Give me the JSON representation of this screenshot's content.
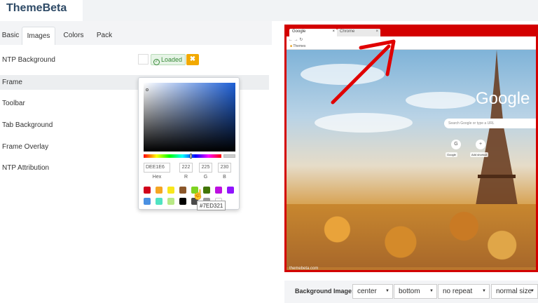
{
  "app": {
    "brand": "ThemeBeta"
  },
  "tabs": [
    {
      "label": "Basic"
    },
    {
      "label": "Images"
    },
    {
      "label": "Colors"
    },
    {
      "label": "Pack"
    }
  ],
  "settings": [
    {
      "label": "NTP Background"
    },
    {
      "label": "Frame"
    },
    {
      "label": "Toolbar"
    },
    {
      "label": "Tab Background"
    },
    {
      "label": "Frame Overlay"
    },
    {
      "label": "NTP Attribution"
    }
  ],
  "ntp_status": {
    "loaded_label": "Loaded",
    "clear_label": "✖"
  },
  "color_picker": {
    "hex": "DEE1E6",
    "r": "222",
    "g": "225",
    "b": "230",
    "hex_label": "Hex",
    "r_label": "R",
    "g_label": "G",
    "b_label": "B",
    "swatches": [
      "#d0021b",
      "#f5a623",
      "#f8e71c",
      "#8b572a",
      "#7ed321",
      "#417505",
      "#bd10e0",
      "#9013fe",
      "#4a90e2",
      "#50e3c2",
      "#b8e986",
      "#000000",
      "#4a4a4a",
      "#9b9b9b",
      "#ffffff"
    ],
    "tooltip": "#7ED321"
  },
  "preview": {
    "tab_active": "Google",
    "tab_inactive": "Chrome",
    "bookmark": "Themes",
    "google_logo": "Google",
    "search_placeholder": "Search Google or type a URL",
    "shortcut_google": "Google",
    "shortcut_add": "Add shortcut",
    "watermark": "themebeta.com",
    "frame_color": "#d30000"
  },
  "background_image": {
    "label": "Background Image:",
    "position_x": "center",
    "position_y": "bottom",
    "repeat": "no repeat",
    "size": "normal size"
  }
}
